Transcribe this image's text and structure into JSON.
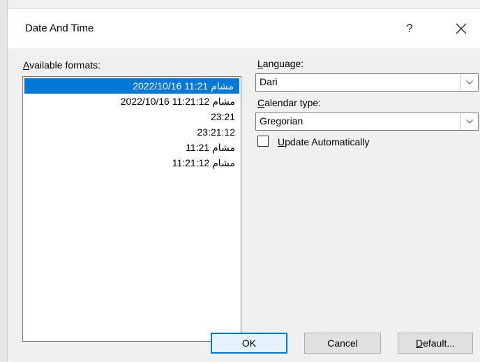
{
  "dialog": {
    "title": "Date And Time",
    "help_label": "?"
  },
  "formats": {
    "label_prefix": "A",
    "label_rest": "vailable formats:",
    "items": [
      "مشام 11:21 2022/10/16",
      "مشام 11:21:12 2022/10/16",
      "23:21",
      "23:21:12",
      "مشام 11:21",
      "مشام 11:21:12"
    ],
    "selected_index": 0
  },
  "language": {
    "label_prefix": "L",
    "label_rest": "anguage:",
    "value": "Dari"
  },
  "calendar": {
    "label_prefix": "C",
    "label_rest": "alendar type:",
    "value": "Gregorian"
  },
  "update": {
    "label_prefix": "U",
    "label_rest": "pdate Automatically",
    "checked": false
  },
  "buttons": {
    "ok": "OK",
    "cancel": "Cancel",
    "default_prefix": "D",
    "default_rest": "efault..."
  },
  "colors": {
    "selection": "#0078d7",
    "button_focus_border": "#0078d7"
  },
  "icons": [
    "close-icon",
    "chevron-down-icon"
  ]
}
